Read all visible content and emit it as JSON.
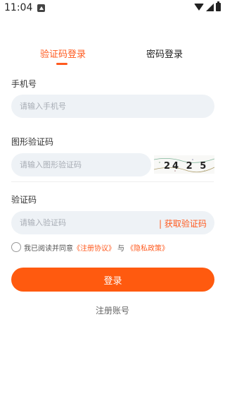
{
  "status_bar": {
    "time": "11:04"
  },
  "tabs": {
    "sms_login": "验证码登录",
    "password_login": "密码登录"
  },
  "phone": {
    "label": "手机号",
    "placeholder": "请输入手机号"
  },
  "captcha": {
    "label": "图形验证码",
    "placeholder": "请输入图形验证码",
    "image_text": "24 2 5"
  },
  "sms_code": {
    "label": "验证码",
    "placeholder": "请输入验证码",
    "get_code_label": "| 获取验证码"
  },
  "agreement": {
    "prefix": "我已阅读并同意",
    "register_agreement": "《注册协议》",
    "connector": "与",
    "privacy_policy": "《隐私政策》"
  },
  "login_button": "登录",
  "register_link": "注册账号",
  "colors": {
    "accent": "#ff5a1f",
    "input_bg": "#eef2f6"
  }
}
